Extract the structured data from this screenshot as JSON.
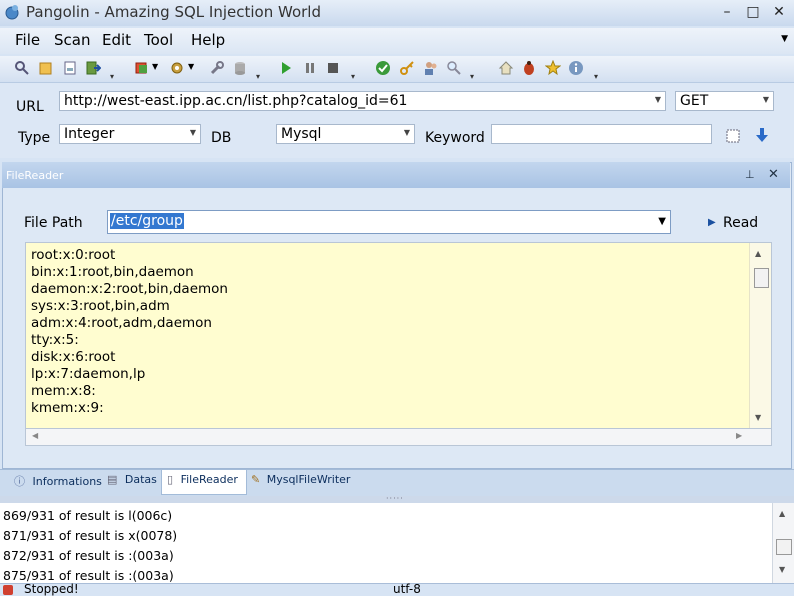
{
  "window": {
    "title": "Pangolin - Amazing SQL Injection World"
  },
  "menu": [
    "File",
    "Scan",
    "Edit",
    "Tool",
    "Help"
  ],
  "form": {
    "url_label": "URL",
    "url_value": "http://west-east.ipp.ac.cn/list.php?catalog_id=61",
    "method": "GET",
    "type_label": "Type",
    "type_value": "Integer",
    "db_label": "DB",
    "db_value": "Mysql",
    "keyword_label": "Keyword",
    "keyword_value": ""
  },
  "panel": {
    "title": "FileReader",
    "file_path_label": "File Path",
    "file_path_value": "/etc/group",
    "read_label": "Read",
    "lines": [
      "root:x:0:root",
      "bin:x:1:root,bin,daemon",
      "daemon:x:2:root,bin,daemon",
      "sys:x:3:root,bin,adm",
      "adm:x:4:root,adm,daemon",
      "tty:x:5:",
      "disk:x:6:root",
      "lp:x:7:daemon,lp",
      "mem:x:8:",
      "kmem:x:9:"
    ]
  },
  "tabs": [
    "Informations",
    "Datas",
    "FileReader",
    "MysqlFileWriter"
  ],
  "log": [
    "869/931 of result is l(006c)",
    "871/931 of result is x(0078)",
    "872/931 of result is :(003a)",
    "875/931 of result is :(003a)"
  ],
  "status": {
    "text": "Stopped!",
    "encoding": "utf-8"
  },
  "colors": {
    "accent": "#3478d0",
    "content_bg": "#fffdd0",
    "panel_head": "#a9c3e4"
  }
}
